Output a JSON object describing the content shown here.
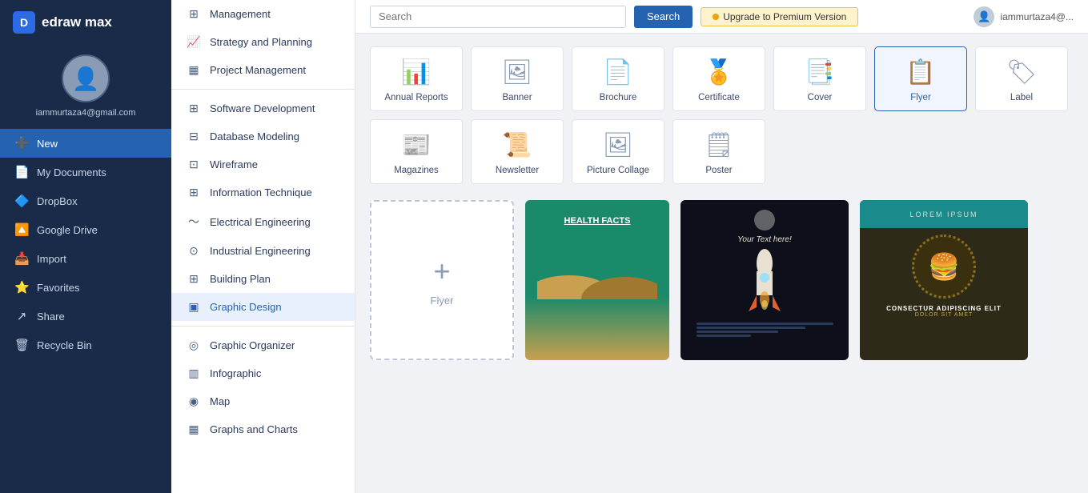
{
  "app": {
    "name": "edraw max",
    "logo_letter": "D"
  },
  "user": {
    "email": "iammurtaza4@gmail.com",
    "avatar_icon": "👤"
  },
  "topbar": {
    "search_placeholder": "Search",
    "search_btn_label": "Search",
    "upgrade_label": "Upgrade to Premium Version",
    "user_display": "iammurtaza4@..."
  },
  "sidebar_nav": [
    {
      "id": "new",
      "label": "New",
      "icon": "➕",
      "active": true
    },
    {
      "id": "my-documents",
      "label": "My Documents",
      "icon": "📄",
      "active": false
    },
    {
      "id": "dropbox",
      "label": "DropBox",
      "icon": "🔷",
      "active": false
    },
    {
      "id": "google-drive",
      "label": "Google Drive",
      "icon": "🔼",
      "active": false
    },
    {
      "id": "import",
      "label": "Import",
      "icon": "📥",
      "active": false
    },
    {
      "id": "favorites",
      "label": "Favorites",
      "icon": "⭐",
      "active": false
    },
    {
      "id": "share",
      "label": "Share",
      "icon": "↗",
      "active": false
    },
    {
      "id": "recycle-bin",
      "label": "Recycle Bin",
      "icon": "🗑",
      "active": false
    }
  ],
  "middle_items": [
    {
      "id": "management",
      "label": "Management",
      "icon": "⊞",
      "active": false
    },
    {
      "id": "strategy-planning",
      "label": "Strategy and Planning",
      "icon": "📈",
      "active": false
    },
    {
      "id": "project-management",
      "label": "Project Management",
      "icon": "▦",
      "active": false
    },
    {
      "id": "software-dev",
      "label": "Software Development",
      "icon": "⊞",
      "active": false
    },
    {
      "id": "database-modeling",
      "label": "Database Modeling",
      "icon": "⊟",
      "active": false
    },
    {
      "id": "wireframe",
      "label": "Wireframe",
      "icon": "⊡",
      "active": false
    },
    {
      "id": "info-technique",
      "label": "Information Technique",
      "icon": "⊞",
      "active": false
    },
    {
      "id": "electrical-eng",
      "label": "Electrical Engineering",
      "icon": "〜",
      "active": false
    },
    {
      "id": "industrial-eng",
      "label": "Industrial Engineering",
      "icon": "⊙",
      "active": false
    },
    {
      "id": "building-plan",
      "label": "Building Plan",
      "icon": "⊞",
      "active": false
    },
    {
      "id": "graphic-design",
      "label": "Graphic Design",
      "icon": "▣",
      "active": true
    },
    {
      "id": "graphic-organizer",
      "label": "Graphic Organizer",
      "icon": "◎",
      "active": false
    },
    {
      "id": "infographic",
      "label": "Infographic",
      "icon": "▥",
      "active": false
    },
    {
      "id": "map",
      "label": "Map",
      "icon": "◉",
      "active": false
    },
    {
      "id": "graphs-charts",
      "label": "Graphs and Charts",
      "icon": "▦",
      "active": false
    }
  ],
  "categories": [
    {
      "id": "annual-reports",
      "label": "Annual Reports",
      "icon_class": "icon-annual",
      "selected": false
    },
    {
      "id": "banner",
      "label": "Banner",
      "icon_class": "icon-banner",
      "selected": false
    },
    {
      "id": "brochure",
      "label": "Brochure",
      "icon_class": "icon-brochure",
      "selected": false
    },
    {
      "id": "certificate",
      "label": "Certificate",
      "icon_class": "icon-certificate",
      "selected": false
    },
    {
      "id": "cover",
      "label": "Cover",
      "icon_class": "icon-cover",
      "selected": false
    },
    {
      "id": "flyer",
      "label": "Flyer",
      "icon_class": "icon-flyer",
      "selected": true
    },
    {
      "id": "label",
      "label": "Label",
      "icon_class": "icon-label",
      "selected": false
    },
    {
      "id": "magazines",
      "label": "Magazines",
      "icon_class": "icon-magazine",
      "selected": false
    },
    {
      "id": "newsletter",
      "label": "Newsletter",
      "icon_class": "icon-newsletter",
      "selected": false
    },
    {
      "id": "picture-collage",
      "label": "Picture Collage",
      "icon_class": "icon-picollage",
      "selected": false
    },
    {
      "id": "poster",
      "label": "Poster",
      "icon_class": "icon-poster",
      "selected": false
    }
  ],
  "create_new_label": "Flyer",
  "health_title": "HEALTH FACTS",
  "space_title": "Your Text here!",
  "burger_lorem": "LOREM IPSUM",
  "burger_text1": "CONSECTUR ADIPISCING ELIT",
  "burger_text2": "DOLOR SIT AMET"
}
